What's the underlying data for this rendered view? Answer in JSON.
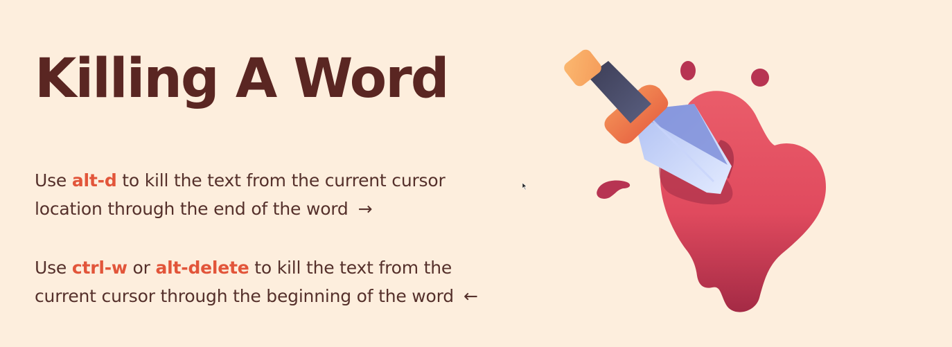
{
  "slide": {
    "title": "Killing A Word",
    "para1": {
      "prefix": "Use ",
      "key": "alt-d",
      "middle": " to kill the text from the current cursor",
      "line2": "location through the end of the word",
      "arrow": "→"
    },
    "para2": {
      "prefix": "Use ",
      "key1": "ctrl-w",
      "joiner": " or ",
      "key2": "alt-delete",
      "middle": " to kill the text from the",
      "line2": "current cursor through the beginning of the word",
      "arrow": "←"
    }
  },
  "illustration": {
    "icon": "dagger-in-heart-icon"
  },
  "colors": {
    "background": "#fdeedd",
    "title": "#5a2622",
    "body_text": "#55302b",
    "key_accent": "#e2553a"
  }
}
